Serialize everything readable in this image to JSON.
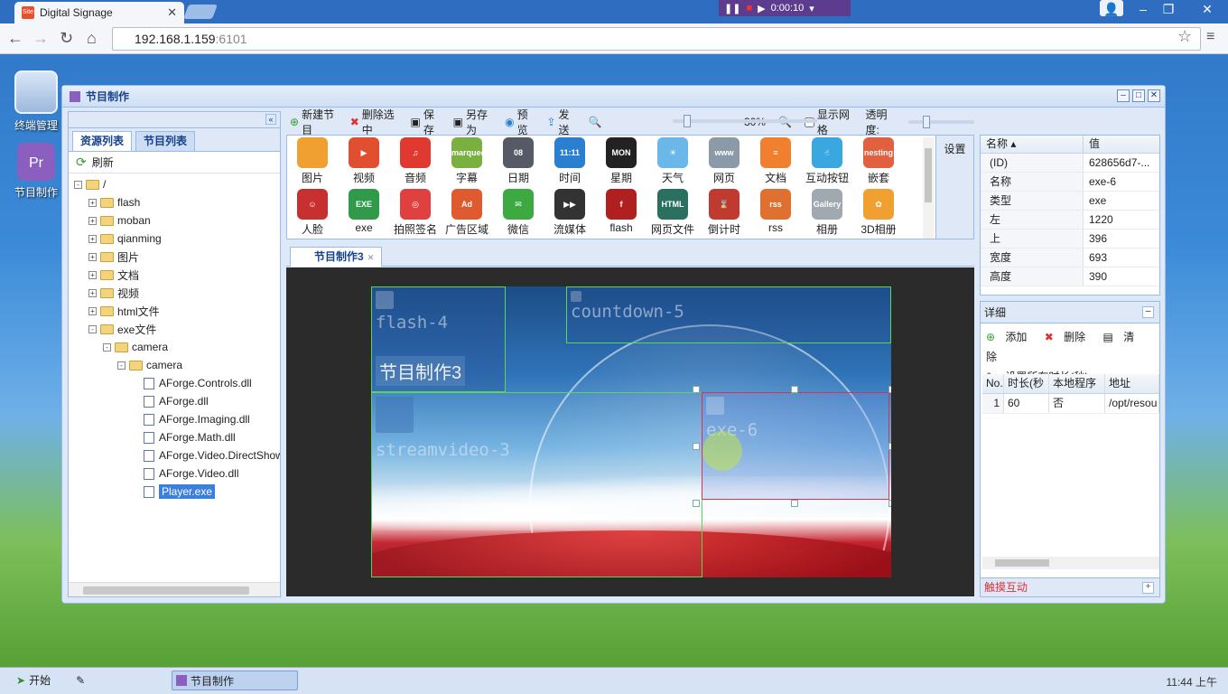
{
  "browser": {
    "tab_title": "Digital Signage",
    "media_time": "0:00:10",
    "url_host": "192.168.1.159",
    "url_port": ":6101"
  },
  "desktop": {
    "icons": [
      {
        "label": "终端管理",
        "icon": "monitor-icon"
      },
      {
        "label": "节目制作",
        "icon": "pr-app-icon"
      }
    ]
  },
  "window": {
    "title": "节目制作"
  },
  "left_panel": {
    "tabs": [
      "资源列表",
      "节目列表"
    ],
    "refresh_label": "刷新",
    "tree": [
      {
        "label": "/",
        "type": "folder",
        "level": 0,
        "expander": "-"
      },
      {
        "label": "flash",
        "type": "folder",
        "level": 1,
        "expander": "+"
      },
      {
        "label": "moban",
        "type": "folder",
        "level": 1,
        "expander": "+"
      },
      {
        "label": "qianming",
        "type": "folder",
        "level": 1,
        "expander": "+"
      },
      {
        "label": "图片",
        "type": "folder",
        "level": 1,
        "expander": "+"
      },
      {
        "label": "文档",
        "type": "folder",
        "level": 1,
        "expander": "+"
      },
      {
        "label": "视频",
        "type": "folder",
        "level": 1,
        "expander": "+"
      },
      {
        "label": "html文件",
        "type": "folder",
        "level": 1,
        "expander": "+"
      },
      {
        "label": "exe文件",
        "type": "folder",
        "level": 1,
        "expander": "-"
      },
      {
        "label": "camera",
        "type": "folder",
        "level": 2,
        "expander": "-"
      },
      {
        "label": "camera",
        "type": "folder",
        "level": 3,
        "expander": "-"
      },
      {
        "label": "AForge.Controls.dll",
        "type": "file",
        "level": 4
      },
      {
        "label": "AForge.dll",
        "type": "file",
        "level": 4
      },
      {
        "label": "AForge.Imaging.dll",
        "type": "file",
        "level": 4
      },
      {
        "label": "AForge.Math.dll",
        "type": "file",
        "level": 4
      },
      {
        "label": "AForge.Video.DirectShow",
        "type": "file",
        "level": 4
      },
      {
        "label": "AForge.Video.dll",
        "type": "file",
        "level": 4
      },
      {
        "label": "Player.exe",
        "type": "file",
        "level": 4,
        "selected": true
      }
    ]
  },
  "toolbar": {
    "new_program": "新建节目",
    "delete_selected": "删除选中",
    "save": "保存",
    "save_as": "另存为",
    "preview": "预览",
    "send": "发送",
    "zoom": "30%",
    "show_grid": "显示网格",
    "opacity": "透明度:"
  },
  "palette": {
    "settings": "设置",
    "items": [
      {
        "label": "图片",
        "color": "#f0a030",
        "glyph": ""
      },
      {
        "label": "视频",
        "color": "#e05030",
        "glyph": "▶"
      },
      {
        "label": "音频",
        "color": "#e03a30",
        "glyph": "♫"
      },
      {
        "label": "字幕",
        "color": "#7ab040",
        "glyph": "marquee"
      },
      {
        "label": "日期",
        "color": "#555a66",
        "glyph": "08"
      },
      {
        "label": "时间",
        "color": "#2a7fd0",
        "glyph": "11:11"
      },
      {
        "label": "星期",
        "color": "#222222",
        "glyph": "MON"
      },
      {
        "label": "天气",
        "color": "#6ab8ea",
        "glyph": "☀"
      },
      {
        "label": "网页",
        "color": "#8a9aa8",
        "glyph": "www"
      },
      {
        "label": "文档",
        "color": "#f08030",
        "glyph": "≡"
      },
      {
        "label": "互动按钮",
        "color": "#3aa8e0",
        "glyph": "☝"
      },
      {
        "label": "嵌套",
        "color": "#e06040",
        "glyph": "nesting"
      },
      {
        "label": "人脸",
        "color": "#c83030",
        "glyph": "☺"
      },
      {
        "label": "exe",
        "color": "#2e9a4a",
        "glyph": "EXE"
      },
      {
        "label": "拍照签名",
        "color": "#e04040",
        "glyph": "◎"
      },
      {
        "label": "广告区域",
        "color": "#e05a30",
        "glyph": "Ad"
      },
      {
        "label": "微信",
        "color": "#3caa40",
        "glyph": "✉"
      },
      {
        "label": "流媒体",
        "color": "#333333",
        "glyph": "▶▶"
      },
      {
        "label": "flash",
        "color": "#b02020",
        "glyph": "f"
      },
      {
        "label": "网页文件",
        "color": "#2a7060",
        "glyph": "HTML"
      },
      {
        "label": "倒计时",
        "color": "#c03a30",
        "glyph": "⌛"
      },
      {
        "label": "rss",
        "color": "#e07030",
        "glyph": "rss"
      },
      {
        "label": "相册",
        "color": "#a0a8b0",
        "glyph": "Gallery"
      },
      {
        "label": "3D相册",
        "color": "#f0a030",
        "glyph": "✿"
      }
    ]
  },
  "doc_tab": {
    "label": "节目制作3"
  },
  "stage": {
    "program_title": "节目制作3",
    "regions": [
      {
        "id": "flashreg",
        "name": "flash-4"
      },
      {
        "id": "cdreg",
        "name": "countdown-5"
      },
      {
        "id": "svreg",
        "name": "streamvideo-3"
      },
      {
        "id": "exereg",
        "name": "exe-6"
      }
    ]
  },
  "properties": {
    "col_name": "名称",
    "col_value": "值",
    "rows": [
      {
        "k": "(ID)",
        "v": "628656d7-..."
      },
      {
        "k": "名称",
        "v": "exe-6"
      },
      {
        "k": "类型",
        "v": "exe"
      },
      {
        "k": "左",
        "v": "1220"
      },
      {
        "k": "上",
        "v": "396"
      },
      {
        "k": "宽度",
        "v": "693"
      },
      {
        "k": "高度",
        "v": "390"
      }
    ]
  },
  "detail": {
    "title": "详细",
    "add": "添加",
    "delete": "删除",
    "clear": "清除",
    "set_all": "设置所有时长(秒)",
    "headers": [
      "No.",
      "时长(秒",
      "本地程序",
      "地址"
    ],
    "rows": [
      [
        "1",
        "60",
        "否",
        "/opt/resou"
      ]
    ]
  },
  "touch": {
    "label": "触摸互动"
  },
  "taskbar": {
    "start": "开始",
    "item": "节目制作",
    "clock": "11:44 上午"
  }
}
